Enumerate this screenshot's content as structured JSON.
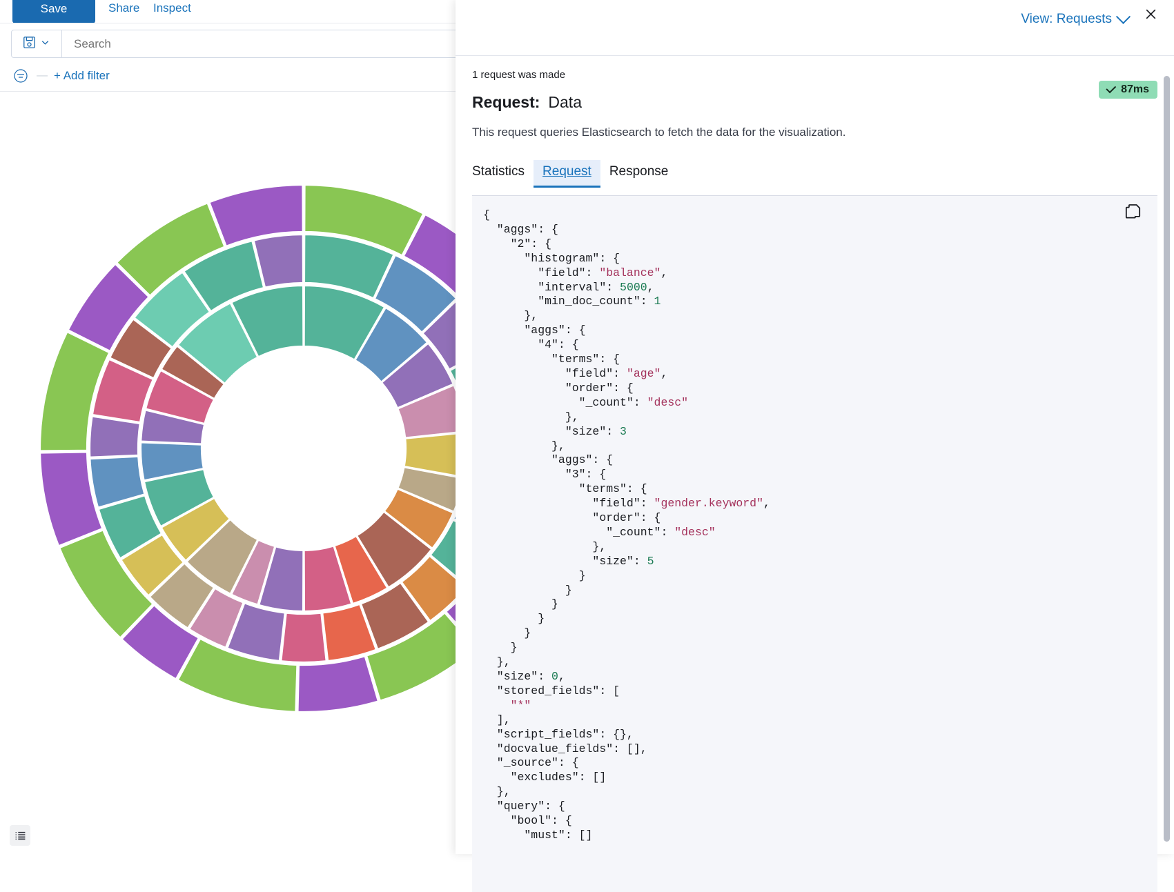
{
  "app": {
    "topnav": {
      "save_label": "Save",
      "share_label": "Share",
      "inspect_label": "Inspect"
    },
    "query_bar": {
      "saved_query_icon": "save-disk-icon",
      "dropdown_icon": "chevron-down-icon",
      "search_placeholder": "Search",
      "search_value": ""
    },
    "filter_bar": {
      "filter_icon": "filter-options-icon",
      "separator": "—",
      "add_filter_label": "+ Add filter"
    },
    "visualization": {
      "type": "sunburst-pie-chart",
      "legend_toggle_icon": "legend-list-icon"
    }
  },
  "flyout": {
    "view_selector_label": "View: Requests",
    "view_selector_icon": "chevron-down-icon",
    "close_icon": "close-icon",
    "request_count_text": "1 request was made",
    "request_label": "Request:",
    "request_name": "Data",
    "duration_badge": "87ms",
    "duration_badge_icon": "check-icon",
    "description": "This request queries Elasticsearch to fetch the data for the visualization.",
    "tabs": [
      {
        "label": "Statistics",
        "active": false
      },
      {
        "label": "Request",
        "active": true
      },
      {
        "label": "Response",
        "active": false
      }
    ],
    "copy_icon": "copy-clipboard-icon",
    "request_body": "{\n  \"aggs\": {\n    \"2\": {\n      \"histogram\": {\n        \"field\": \"balance\",\n        \"interval\": 5000,\n        \"min_doc_count\": 1\n      },\n      \"aggs\": {\n        \"4\": {\n          \"terms\": {\n            \"field\": \"age\",\n            \"order\": {\n              \"_count\": \"desc\"\n            },\n            \"size\": 3\n          },\n          \"aggs\": {\n            \"3\": {\n              \"terms\": {\n                \"field\": \"gender.keyword\",\n                \"order\": {\n                  \"_count\": \"desc\"\n                },\n                \"size\": 5\n              }\n            }\n          }\n        }\n      }\n    }\n  },\n  \"size\": 0,\n  \"stored_fields\": [\n    \"*\"\n  ],\n  \"script_fields\": {},\n  \"docvalue_fields\": [],\n  \"_source\": {\n    \"excludes\": []\n  },\n  \"query\": {\n    \"bool\": {\n      \"must\": []"
  },
  "chart_data": {
    "type": "pie",
    "title": "",
    "description": "Three-ring sunburst: inner ring = balance histogram buckets (interval 5000), middle ring = top 3 age terms, outer ring = top 5 gender.keyword terms",
    "rings": [
      {
        "name": "balance (histogram, interval 5000)",
        "inner_radius": 148,
        "outer_radius": 236,
        "slices": [
          {
            "value": 52,
            "color": "#54b399"
          },
          {
            "value": 34,
            "color": "#6092c0"
          },
          {
            "value": 30,
            "color": "#9170b8"
          },
          {
            "value": 30,
            "color": "#ca8eae"
          },
          {
            "value": 28,
            "color": "#d6bf57"
          },
          {
            "value": 22,
            "color": "#b9a888"
          },
          {
            "value": 26,
            "color": "#da8b45"
          },
          {
            "value": 36,
            "color": "#aa6556"
          },
          {
            "value": 24,
            "color": "#e7664c"
          },
          {
            "value": 30,
            "color": "#d36086"
          },
          {
            "value": 28,
            "color": "#9170b8"
          },
          {
            "value": 18,
            "color": "#ca8eae"
          },
          {
            "value": 34,
            "color": "#b9a888"
          },
          {
            "value": 26,
            "color": "#d6bf57"
          },
          {
            "value": 30,
            "color": "#54b399"
          },
          {
            "value": 24,
            "color": "#6092c0"
          },
          {
            "value": 20,
            "color": "#9170b8"
          },
          {
            "value": 26,
            "color": "#d36086"
          },
          {
            "value": 18,
            "color": "#aa6556"
          },
          {
            "value": 42,
            "color": "#6dccb1"
          },
          {
            "value": 46,
            "color": "#54b399"
          }
        ]
      },
      {
        "name": "age (terms, size 3)",
        "inner_radius": 240,
        "outer_radius": 310,
        "slices": [
          {
            "value": 22,
            "color": "#54b399"
          },
          {
            "value": 18,
            "color": "#6092c0"
          },
          {
            "value": 14,
            "color": "#9170b8"
          },
          {
            "value": 12,
            "color": "#54b399"
          },
          {
            "value": 14,
            "color": "#d6bf57"
          },
          {
            "value": 11,
            "color": "#b9a888"
          },
          {
            "value": 10,
            "color": "#6092c0"
          },
          {
            "value": 13,
            "color": "#54b399"
          },
          {
            "value": 12,
            "color": "#da8b45"
          },
          {
            "value": 14,
            "color": "#aa6556"
          },
          {
            "value": 12,
            "color": "#e7664c"
          },
          {
            "value": 11,
            "color": "#d36086"
          },
          {
            "value": 13,
            "color": "#9170b8"
          },
          {
            "value": 10,
            "color": "#ca8eae"
          },
          {
            "value": 12,
            "color": "#b9a888"
          },
          {
            "value": 11,
            "color": "#d6bf57"
          },
          {
            "value": 13,
            "color": "#54b399"
          },
          {
            "value": 12,
            "color": "#6092c0"
          },
          {
            "value": 10,
            "color": "#9170b8"
          },
          {
            "value": 14,
            "color": "#d36086"
          },
          {
            "value": 11,
            "color": "#aa6556"
          },
          {
            "value": 16,
            "color": "#6dccb1"
          },
          {
            "value": 18,
            "color": "#54b399"
          },
          {
            "value": 12,
            "color": "#9170b8"
          }
        ]
      },
      {
        "name": "gender.keyword (terms, size 5)",
        "inner_radius": 314,
        "outer_radius": 382,
        "slices": [
          {
            "value": 9,
            "color": "#89c653"
          },
          {
            "value": 7,
            "color": "#9b59c4"
          },
          {
            "value": 8,
            "color": "#89c653"
          },
          {
            "value": 6,
            "color": "#9b59c4"
          },
          {
            "value": 9,
            "color": "#89c653"
          },
          {
            "value": 7,
            "color": "#9b59c4"
          },
          {
            "value": 8,
            "color": "#89c653"
          },
          {
            "value": 6,
            "color": "#9b59c4"
          },
          {
            "value": 9,
            "color": "#89c653"
          },
          {
            "value": 5,
            "color": "#9b59c4"
          },
          {
            "value": 8,
            "color": "#89c653"
          },
          {
            "value": 7,
            "color": "#9b59c4"
          },
          {
            "value": 9,
            "color": "#89c653"
          },
          {
            "value": 6,
            "color": "#9b59c4"
          },
          {
            "value": 8,
            "color": "#89c653"
          },
          {
            "value": 7,
            "color": "#9b59c4"
          }
        ]
      }
    ],
    "palette": [
      "#54b399",
      "#6092c0",
      "#9170b8",
      "#ca8eae",
      "#d6bf57",
      "#b9a888",
      "#da8b45",
      "#aa6556",
      "#e7664c",
      "#d36086",
      "#6dccb1",
      "#89c653",
      "#9b59c4",
      "#3f51b5",
      "#4ba6c9"
    ]
  },
  "colors": {
    "primary": "#1a6ab0",
    "link": "#1a73bb",
    "success_badge": "#8fdcb5",
    "code_bg": "#f5f6fa",
    "string": "#a4325c",
    "number": "#1a7a52"
  }
}
